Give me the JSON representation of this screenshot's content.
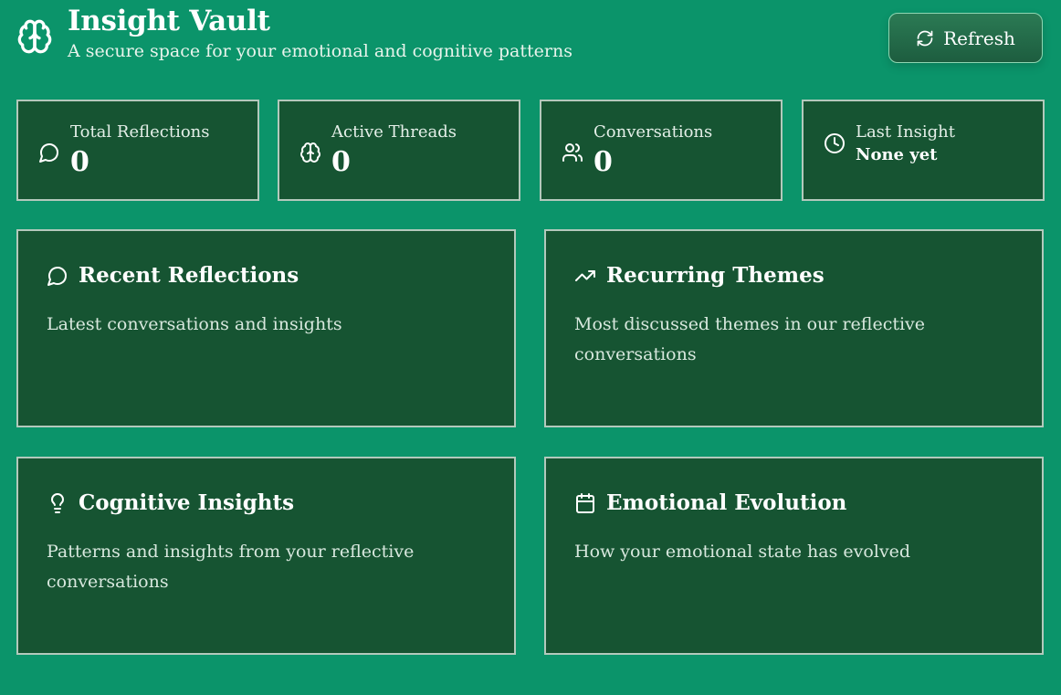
{
  "header": {
    "title": "Insight Vault",
    "subtitle": "A secure space for your emotional and cognitive patterns",
    "logo_icon": "brain-icon"
  },
  "toolbar": {
    "refresh_label": "Refresh",
    "refresh_icon": "refresh-icon"
  },
  "stats": [
    {
      "label": "Total Reflections",
      "value": "0",
      "icon": "message-circle-icon"
    },
    {
      "label": "Active Threads",
      "value": "0",
      "icon": "brain-icon"
    },
    {
      "label": "Conversations",
      "value": "0",
      "icon": "users-icon"
    },
    {
      "label": "Last Insight",
      "value": "None yet",
      "icon": "clock-icon"
    }
  ],
  "cards": [
    {
      "title": "Recent Reflections",
      "description": "Latest conversations and insights",
      "icon": "message-circle-icon"
    },
    {
      "title": "Recurring Themes",
      "description": "Most discussed themes in our reflective conversations",
      "icon": "trending-up-icon"
    },
    {
      "title": "Cognitive Insights",
      "description": "Patterns and insights from your reflective conversations",
      "icon": "lightbulb-icon"
    },
    {
      "title": "Emotional Evolution",
      "description": "How your emotional state has evolved",
      "icon": "calendar-icon"
    }
  ],
  "colors": {
    "background": "#0b946a",
    "panel": "#165432",
    "border": "#b3c9bc",
    "button": "#1d5d3f",
    "text": "#ffffff"
  }
}
